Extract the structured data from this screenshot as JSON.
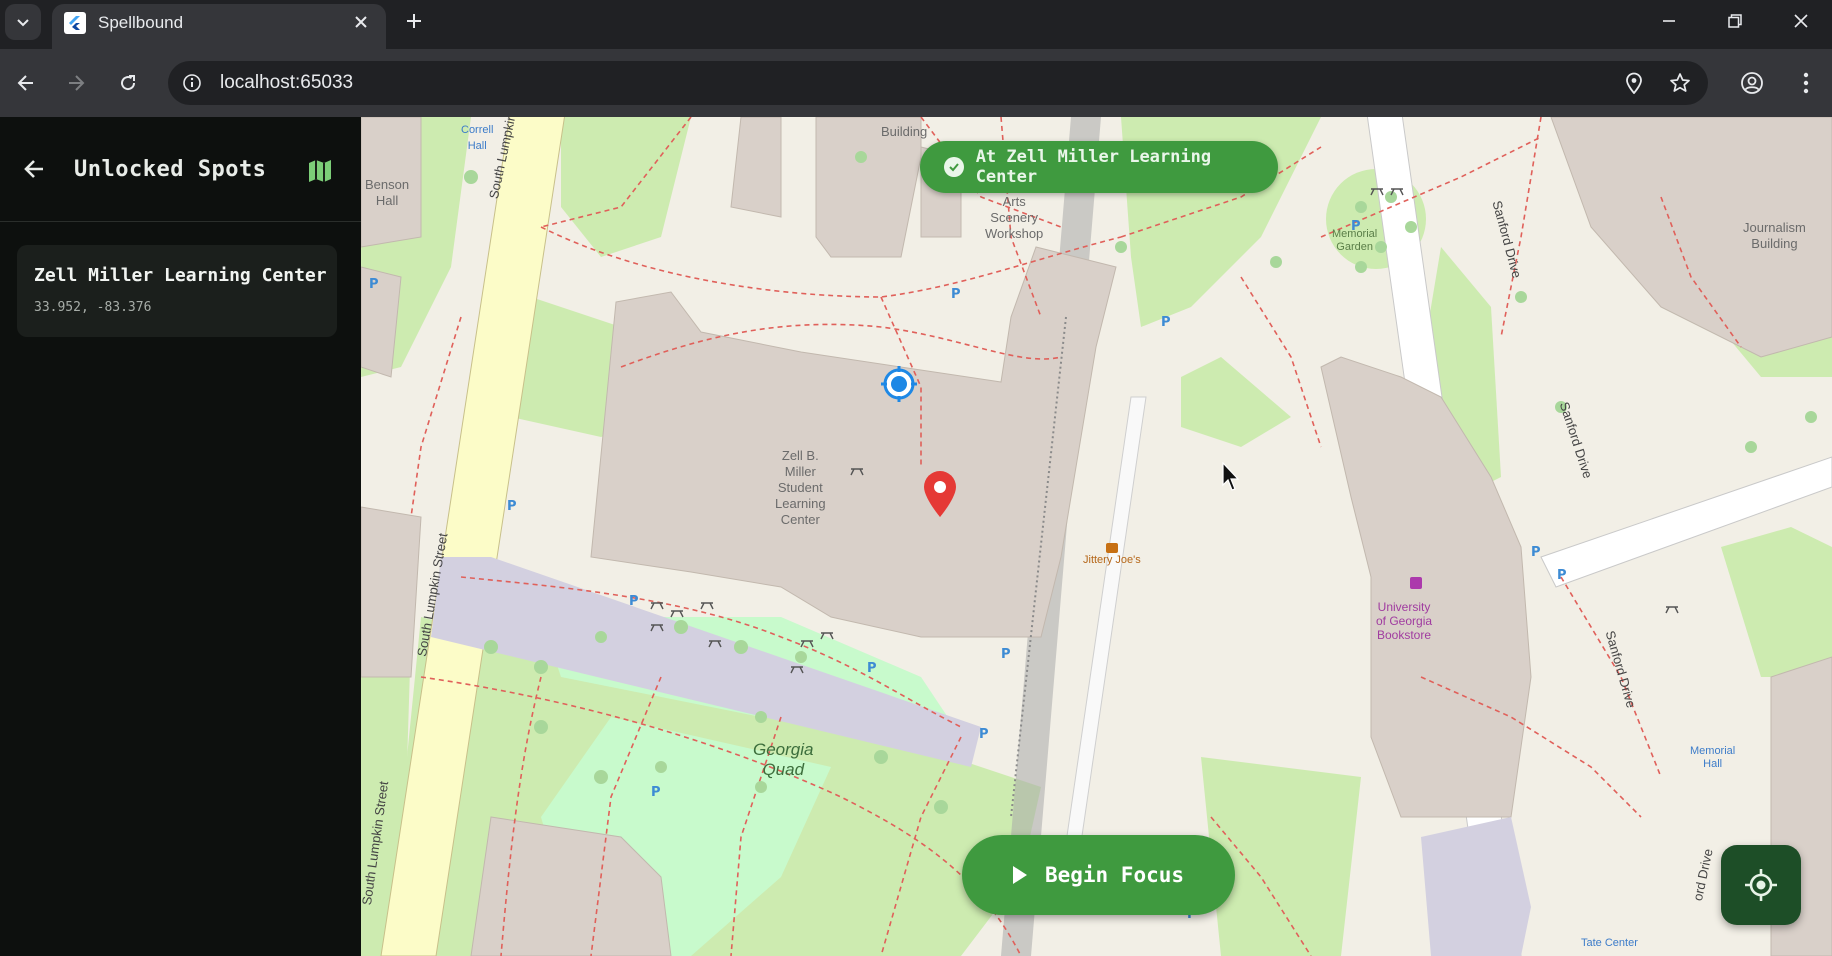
{
  "browser": {
    "tab_title": "Spellbound",
    "url": "localhost:65033",
    "icons": {
      "tab_search": "chevron-down-icon",
      "close_tab": "close-icon",
      "new_tab": "plus-icon",
      "back": "arrow-left-icon",
      "forward": "arrow-right-icon",
      "reload": "reload-icon",
      "site_info": "info-icon",
      "location": "location-pin-icon",
      "bookmark": "star-icon",
      "profile": "account-icon",
      "menu": "kebab-menu-icon"
    }
  },
  "sidebar": {
    "title": "Unlocked Spots",
    "spots": [
      {
        "name": "Zell Miller Learning Center",
        "coords": "33.952, -83.376"
      }
    ]
  },
  "map": {
    "labels": {
      "correll": "Correll\nHall",
      "benson": "Benson\nHall",
      "building": "Building",
      "arts": "Arts\nScenery\nWorkshop",
      "memorial_garden": "Memorial\nGarden",
      "journalism": "Journalism\nBuilding",
      "zell": "Zell B.\nMiller\nStudent\nLearning\nCenter",
      "jittery": "Jittery Joe's",
      "bookstore": "University\nof Georgia\nBookstore",
      "memorial_hall": "Memorial\nHall",
      "georgia_quad": "Georgia\nQuad",
      "tate": "Tate Center",
      "south_lumpkin_1": "South Lumpkin Street",
      "south_lumpkin_2": "South Lumpkin Street",
      "south_lumpkin_3": "South Lumpkin Street",
      "sanford_1": "Sanford Drive",
      "sanford_2": "Sanford Drive",
      "sanford_3": "Sanford Drive",
      "sanford_4": "ord Drive"
    },
    "toast": "At Zell Miller Learning Center",
    "begin_focus": "Begin Focus",
    "colors": {
      "accent_green": "#3f9a3f",
      "locate_button": "#1d4e27",
      "sidebar_bg": "#0d100e",
      "marker_red": "#e53935",
      "user_dot_blue": "#1e88e5"
    }
  }
}
